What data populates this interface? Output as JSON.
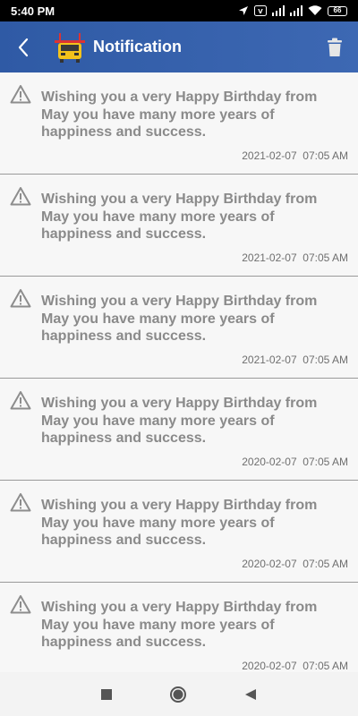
{
  "status_bar": {
    "time": "5:40 PM",
    "battery": "66"
  },
  "app_bar": {
    "title": "Notification"
  },
  "notifications": [
    {
      "message": "Wishing you a very Happy Birthday from  May you have many more years of happiness and success.",
      "date": "2021-02-07",
      "time": "07:05 AM"
    },
    {
      "message": "Wishing you a very Happy Birthday from  May you have many more years of happiness and success.",
      "date": "2021-02-07",
      "time": "07:05 AM"
    },
    {
      "message": "Wishing you a very Happy Birthday from  May you have many more years of happiness and success.",
      "date": "2021-02-07",
      "time": "07:05 AM"
    },
    {
      "message": "Wishing you a very Happy Birthday from  May you have many more years of happiness and success.",
      "date": "2020-02-07",
      "time": "07:05 AM"
    },
    {
      "message": "Wishing you a very Happy Birthday from  May you have many more years of happiness and success.",
      "date": "2020-02-07",
      "time": "07:05 AM"
    },
    {
      "message": "Wishing you a very Happy Birthday from  May you have many more years of happiness and success.",
      "date": "2020-02-07",
      "time": "07:05 AM"
    }
  ],
  "colors": {
    "app_bar": "#2f5aa5",
    "message_text": "#8a8a8a",
    "divider": "#9a9a9a"
  }
}
